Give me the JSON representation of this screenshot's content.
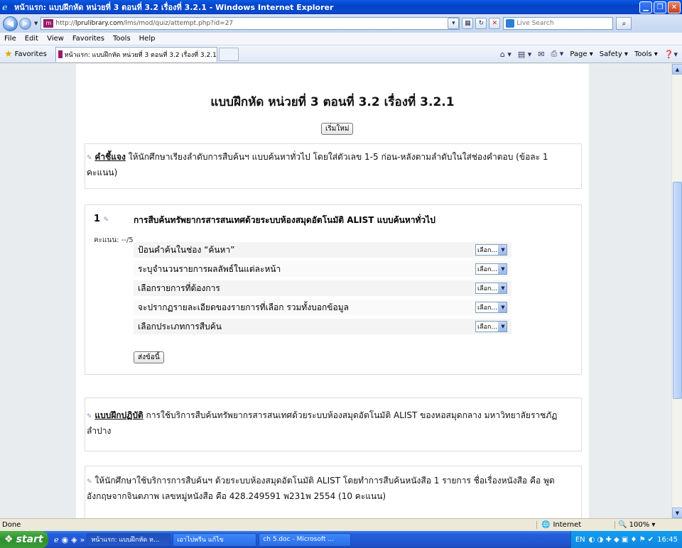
{
  "window": {
    "title": "หน้าแรก: แบบฝึกหัด หน่วยที่ 3 ตอนที่ 3.2 เรื่องที่ 3.2.1 - Windows Internet Explorer"
  },
  "address": {
    "url_prefix": "http://",
    "url_host": "lprulibrary.com",
    "url_path": "/lms/mod/quiz/attempt.php?id=27",
    "search_placeholder": "Live Search"
  },
  "menu": [
    "File",
    "Edit",
    "View",
    "Favorites",
    "Tools",
    "Help"
  ],
  "favbar": {
    "favorites_label": "Favorites",
    "tab_title": "หน้าแรก: แบบฝึกหัด หน่วยที่ 3 ตอนที่ 3.2 เรื่องที่ 3.2.1",
    "cmd_page": "Page ▾",
    "cmd_safety": "Safety ▾",
    "cmd_tools": "Tools ▾"
  },
  "quiz": {
    "heading": "แบบฝึกหัด หน่วยที่ 3 ตอนที่ 3.2 เรื่องที่ 3.2.1",
    "restart_label": "เริ่มใหม่",
    "instruction_title": "คำชี้แจง",
    "instruction_text": " ให้นักศึกษาเรียงลำดับการสืบค้นฯ แบบค้นหาทั่วไป โดยใส่ตัวเลข 1-5 ก่อน-หลังตามลำดับในใส่ช่องคำตอบ (ข้อละ 1 คะแนน)",
    "question": {
      "number": "1",
      "text": "การสืบค้นทรัพยากรสารสนเทศด้วยระบบห้องสมุดอัตโนมัติ ALIST แบบค้นหาทั่วไป",
      "grade": "คะแนน: --/5",
      "items": [
        {
          "label": "ป้อนคำค้นในช่อง “ค้นหา”",
          "selected": "เลือก..."
        },
        {
          "label": "ระบุจำนวนรายการผลลัพธ์ในแต่ละหน้า",
          "selected": "เลือก..."
        },
        {
          "label": "เลือกรายการที่ต้องการ",
          "selected": "เลือก..."
        },
        {
          "label": "จะปรากฏรายละเอียดของรายการที่เลือก รวมทั้งบอกข้อมูล",
          "selected": "เลือก..."
        },
        {
          "label": "เลือกประเภทการสืบค้น",
          "selected": "เลือก..."
        }
      ],
      "submit_label": "ส่งข้อนี้"
    },
    "practice_title": "แบบฝึกปฏิบัติ",
    "practice_text": "  การใช้บริการสืบค้นทรัพยากรสารสนเทศด้วยระบบห้องสมุดอัตโนมัติ ALIST ของหอสมุดกลาง มหาวิทยาลัยราชภัฏลำปาง",
    "task_text": "ให้นักศึกษาใช้บริการการสืบค้นฯ ด้วยระบบห้องสมุดอัตโนมัติ ALIST โดยทำการสืบค้นหนังสือ 1 รายการ ชื่อเรื่องหนังสือ คือ พูดอังกฤษจากจินตภาพ เลขหมู่หนังสือ คือ 428.249591 พ231พ 2554 (10 คะแนน)"
  },
  "status": {
    "left": "Done",
    "zone": "Internet",
    "zoom": "100%"
  },
  "taskbar": {
    "start": "start",
    "tasks": [
      "หน้าแรก: แบบฝึกหัด ห...",
      "เอาไปพรีน แก้ไข",
      "ch 5.doc - Microsoft ..."
    ],
    "tray_lang": "EN",
    "clock": "16:45"
  },
  "colors": {
    "titlebar": "#0543c5",
    "taskbar": "#245edb",
    "start": "#2f8f2e"
  }
}
